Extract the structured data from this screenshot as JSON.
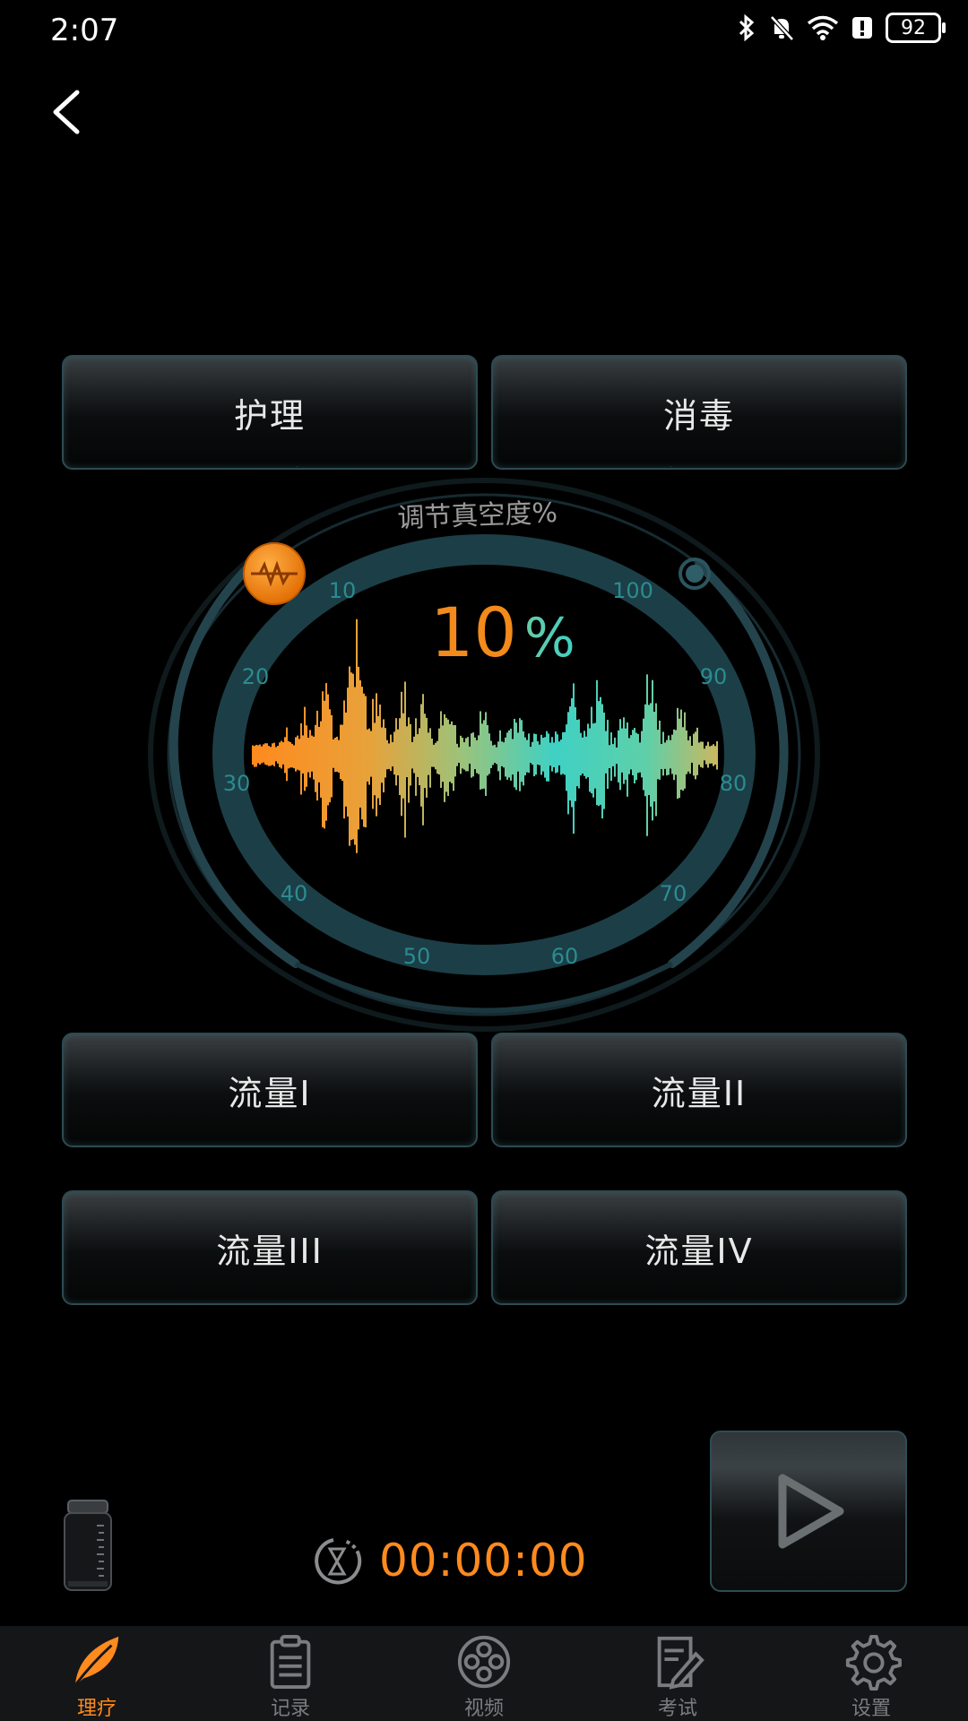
{
  "status_bar": {
    "time": "2:07",
    "battery": "92"
  },
  "header": {
    "back_icon": "chevron-left-icon"
  },
  "modes": {
    "nursing": "护理",
    "disinfect": "消毒"
  },
  "dial": {
    "title": "调节真空度%",
    "value": "10",
    "unit": "%",
    "level_percent": 10,
    "ticks": [
      "10",
      "20",
      "30",
      "40",
      "50",
      "60",
      "70",
      "80",
      "90",
      "100"
    ]
  },
  "flows": {
    "flow1": "流量I",
    "flow2": "流量II",
    "flow3": "流量III",
    "flow4": "流量IV"
  },
  "timer": {
    "value": "00:00:00"
  },
  "tabs": [
    {
      "label": "理疗",
      "icon": "leaf-icon",
      "active": true
    },
    {
      "label": "记录",
      "icon": "clipboard-icon",
      "active": false
    },
    {
      "label": "视频",
      "icon": "film-reel-icon",
      "active": false
    },
    {
      "label": "考试",
      "icon": "exam-pen-icon",
      "active": false
    },
    {
      "label": "设置",
      "icon": "gear-icon",
      "active": false
    }
  ],
  "colors": {
    "accent": "#ff8a1e",
    "teal": "#3fd1c4",
    "dial_ring": "#1c3e47",
    "tick_text": "#2a8c90"
  }
}
